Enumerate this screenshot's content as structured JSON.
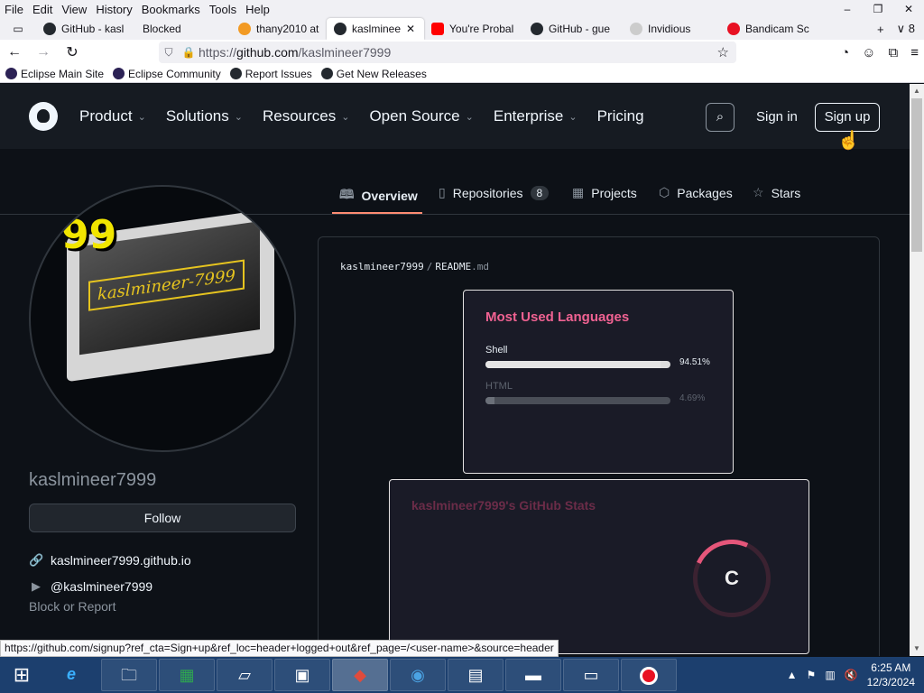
{
  "menubar": {
    "items": [
      "File",
      "Edit",
      "View",
      "History",
      "Bookmarks",
      "Tools",
      "Help"
    ],
    "win_controls": [
      "–",
      "❐",
      "✕"
    ]
  },
  "tabs": [
    {
      "label": "GitHub - kasl",
      "icon_color": "#24292f"
    },
    {
      "label": "Blocked",
      "icon_color": ""
    },
    {
      "label": "thany2010 at",
      "icon_color": "#f29a24"
    },
    {
      "label": "kaslminee",
      "icon_color": "#24292f",
      "active": true
    },
    {
      "label": "You're Probal",
      "icon_color": "#ff0000"
    },
    {
      "label": "GitHub - gue",
      "icon_color": "#24292f"
    },
    {
      "label": "Invidious",
      "icon_color": "#cccccc"
    },
    {
      "label": "Bandicam Sc",
      "icon_color": "#e81123"
    }
  ],
  "tab_tools": {
    "new_tab": "+",
    "tab_count": "8"
  },
  "nav": {
    "url_prefix": "https://",
    "url_host": "github.com",
    "url_path": "/kaslmineer7999"
  },
  "bookmarks": [
    {
      "label": "Eclipse Main Site",
      "icon_color": "#2c2255"
    },
    {
      "label": "Eclipse Community",
      "icon_color": "#2c2255"
    },
    {
      "label": "Report Issues",
      "icon_color": "#24292f"
    },
    {
      "label": "Get New Releases",
      "icon_color": "#24292f"
    }
  ],
  "gh_header": {
    "nav": [
      {
        "label": "Product",
        "has_menu": true
      },
      {
        "label": "Solutions",
        "has_menu": true
      },
      {
        "label": "Resources",
        "has_menu": true
      },
      {
        "label": "Open Source",
        "has_menu": true
      },
      {
        "label": "Enterprise",
        "has_menu": true
      },
      {
        "label": "Pricing",
        "has_menu": false
      }
    ],
    "sign_in": "Sign in",
    "sign_up": "Sign up"
  },
  "profile_tabs": [
    {
      "label": "Overview",
      "icon": "book-icon",
      "glyph": "📖"
    },
    {
      "label": "Repositories",
      "icon": "repo-icon",
      "glyph": "▢",
      "count": "8"
    },
    {
      "label": "Projects",
      "icon": "table-icon",
      "glyph": "▦"
    },
    {
      "label": "Packages",
      "icon": "package-icon",
      "glyph": "⬡"
    },
    {
      "label": "Stars",
      "icon": "star-icon",
      "glyph": "☆"
    }
  ],
  "avatar": {
    "badge": "99",
    "screen_text": "kaslmineer-7999"
  },
  "profile": {
    "username": "kaslmineer7999",
    "follow": "Follow",
    "website": "kaslmineer7999.github.io",
    "youtube": "@kaslmineer7999",
    "block": "Block or Report"
  },
  "readme": {
    "owner": "kaslmineer7999",
    "file": "README",
    "ext": ".md",
    "lang_card": {
      "title": "Most Used Languages",
      "languages": [
        {
          "name": "Shell",
          "percent": 94.51,
          "label": "94.51%"
        },
        {
          "name": "HTML",
          "percent": 4.69,
          "label": "4.69%"
        }
      ]
    },
    "stats_card": {
      "title": "kaslmineer7999's GitHub Stats",
      "rank": "C"
    }
  },
  "status_link": "https://github.com/signup?ref_cta=Sign+up&ref_loc=header+logged+out&ref_page=/<user-name>&source=header",
  "taskbar": {
    "clock_time": "6:25 AM",
    "clock_date": "12/3/2024"
  }
}
